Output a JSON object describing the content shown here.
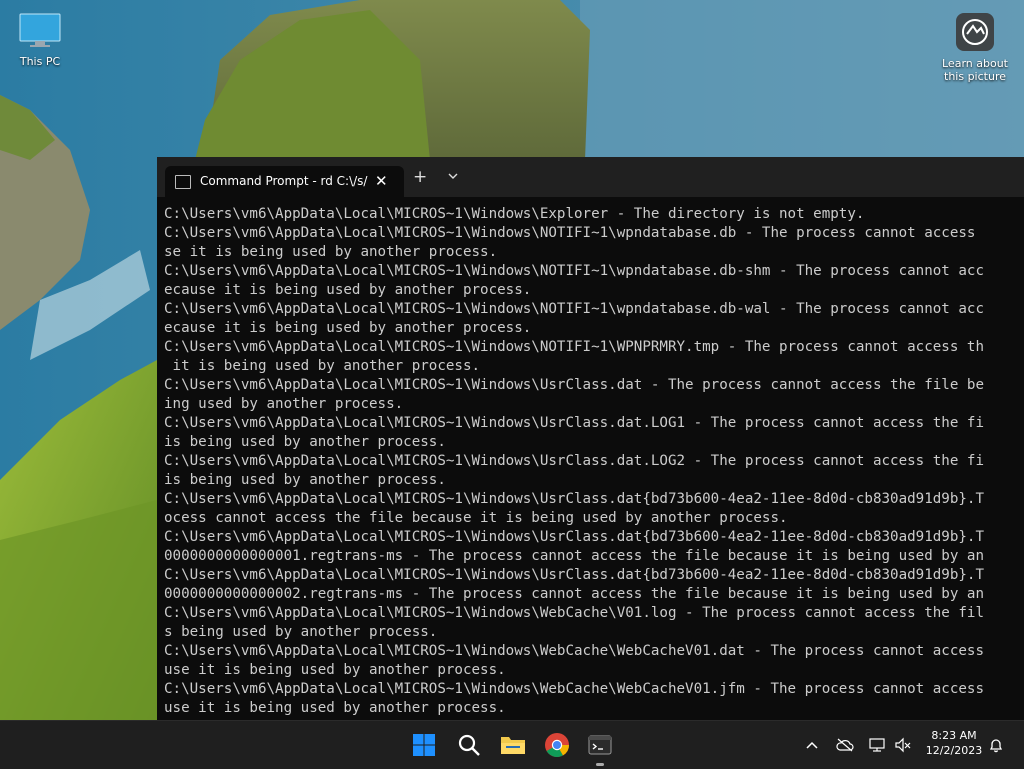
{
  "desktop": {
    "icons": [
      {
        "label": "This PC",
        "icon": "monitor-icon"
      },
      {
        "label": "Learn about\nthis picture",
        "icon": "info-camera-icon"
      }
    ]
  },
  "terminal": {
    "tab_title": "Command Prompt - rd  C:\\/s/",
    "close_glyph": "✕",
    "new_tab_glyph": "+",
    "lines": [
      "C:\\Users\\vm6\\AppData\\Local\\MICROS~1\\Windows\\Explorer - The directory is not empty.",
      "C:\\Users\\vm6\\AppData\\Local\\MICROS~1\\Windows\\NOTIFI~1\\wpndatabase.db - The process cannot access",
      "se it is being used by another process.",
      "C:\\Users\\vm6\\AppData\\Local\\MICROS~1\\Windows\\NOTIFI~1\\wpndatabase.db-shm - The process cannot acc",
      "ecause it is being used by another process.",
      "C:\\Users\\vm6\\AppData\\Local\\MICROS~1\\Windows\\NOTIFI~1\\wpndatabase.db-wal - The process cannot acc",
      "ecause it is being used by another process.",
      "C:\\Users\\vm6\\AppData\\Local\\MICROS~1\\Windows\\NOTIFI~1\\WPNPRMRY.tmp - The process cannot access th",
      " it is being used by another process.",
      "C:\\Users\\vm6\\AppData\\Local\\MICROS~1\\Windows\\UsrClass.dat - The process cannot access the file be",
      "ing used by another process.",
      "C:\\Users\\vm6\\AppData\\Local\\MICROS~1\\Windows\\UsrClass.dat.LOG1 - The process cannot access the fi",
      "is being used by another process.",
      "C:\\Users\\vm6\\AppData\\Local\\MICROS~1\\Windows\\UsrClass.dat.LOG2 - The process cannot access the fi",
      "is being used by another process.",
      "C:\\Users\\vm6\\AppData\\Local\\MICROS~1\\Windows\\UsrClass.dat{bd73b600-4ea2-11ee-8d0d-cb830ad91d9b}.T",
      "ocess cannot access the file because it is being used by another process.",
      "C:\\Users\\vm6\\AppData\\Local\\MICROS~1\\Windows\\UsrClass.dat{bd73b600-4ea2-11ee-8d0d-cb830ad91d9b}.T",
      "0000000000000001.regtrans-ms - The process cannot access the file because it is being used by an",
      "C:\\Users\\vm6\\AppData\\Local\\MICROS~1\\Windows\\UsrClass.dat{bd73b600-4ea2-11ee-8d0d-cb830ad91d9b}.T",
      "0000000000000002.regtrans-ms - The process cannot access the file because it is being used by an",
      "C:\\Users\\vm6\\AppData\\Local\\MICROS~1\\Windows\\WebCache\\V01.log - The process cannot access the fil",
      "s being used by another process.",
      "C:\\Users\\vm6\\AppData\\Local\\MICROS~1\\Windows\\WebCache\\WebCacheV01.dat - The process cannot access",
      "use it is being used by another process.",
      "C:\\Users\\vm6\\AppData\\Local\\MICROS~1\\Windows\\WebCache\\WebCacheV01.jfm - The process cannot access",
      "use it is being used by another process."
    ]
  },
  "taskbar": {
    "apps": [
      {
        "name": "start-button",
        "icon": "windows-logo-icon"
      },
      {
        "name": "search-button",
        "icon": "search-icon"
      },
      {
        "name": "file-explorer-button",
        "icon": "folder-icon"
      },
      {
        "name": "chrome-button",
        "icon": "chrome-icon"
      },
      {
        "name": "terminal-button",
        "icon": "terminal-icon",
        "active": true
      }
    ],
    "tray": {
      "icons": [
        "chevron-up-icon",
        "onedrive-icon",
        "network-icon",
        "volume-muted-icon"
      ],
      "time": "8:23 AM",
      "date": "12/2/2023",
      "notification_icon": "bell-icon"
    }
  },
  "colors": {
    "terminal_bg": "#0c0c0c",
    "terminal_text": "#cccccc",
    "tabbar_bg": "#202020",
    "taskbar_bg": "#1f1f1f",
    "windows_blue": "#1e90ff"
  }
}
